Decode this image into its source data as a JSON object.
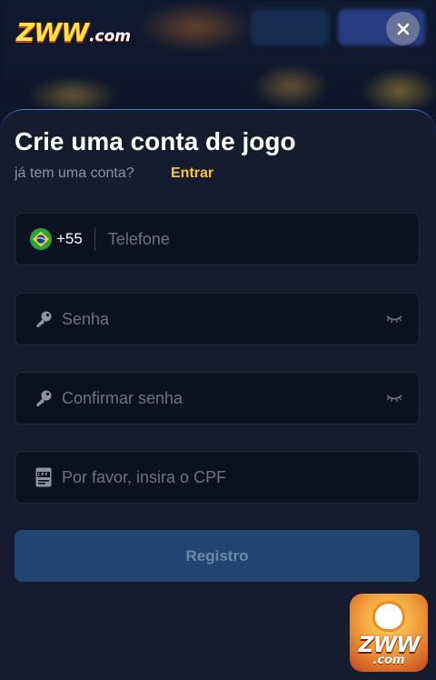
{
  "brand": {
    "logo_main": "ZWW",
    "logo_suffix": ".com"
  },
  "header": {
    "close_icon": "close-icon"
  },
  "form": {
    "title": "Crie uma conta de jogo",
    "has_account_text": "já tem uma conta?",
    "login_link": "Entrar",
    "phone": {
      "country_flag_icon": "brazil-flag-icon",
      "country_code": "+55",
      "placeholder": "Telefone",
      "value": ""
    },
    "password": {
      "icon": "key-icon",
      "placeholder": "Senha",
      "value": "",
      "toggle_icon": "eye-closed-icon"
    },
    "confirm_password": {
      "icon": "key-icon",
      "placeholder": "Confirmar senha",
      "value": "",
      "toggle_icon": "eye-closed-icon"
    },
    "cpf": {
      "icon": "cpf-card-icon",
      "placeholder": "Por favor, insira o CPF",
      "value": ""
    },
    "submit_label": "Registro"
  },
  "floating_app": {
    "label_main": "ZWW",
    "label_suffix": ".com"
  },
  "colors": {
    "accent_link": "#f5c542",
    "submit_bg": "#1f4570",
    "sheet_bg": "#141c2e",
    "sheet_border": "#3d7fd0"
  }
}
